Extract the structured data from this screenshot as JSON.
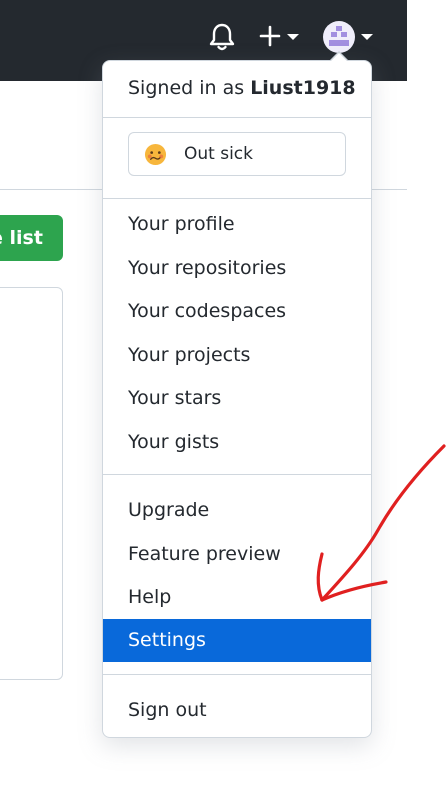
{
  "header": {
    "icons": [
      "bell-icon",
      "plus-icon",
      "chevron-down-icon",
      "avatar",
      "chevron-down-icon"
    ]
  },
  "background": {
    "green_button_label": "e list"
  },
  "dropdown": {
    "signed_in_prefix": "Signed in as",
    "username": "Liust1918",
    "status": {
      "emoji": "sick-face-emoji",
      "label": "Out sick"
    },
    "section_profile": [
      "Your profile",
      "Your repositories",
      "Your codespaces",
      "Your projects",
      "Your stars",
      "Your gists"
    ],
    "section_misc": [
      "Upgrade",
      "Feature preview",
      "Help",
      "Settings"
    ],
    "active_item": "Settings",
    "sign_out": "Sign out"
  },
  "colors": {
    "header_bg": "#24292f",
    "active_bg": "#0969da",
    "green_button": "#2da44e",
    "annotation_arrow": "#e02020"
  }
}
